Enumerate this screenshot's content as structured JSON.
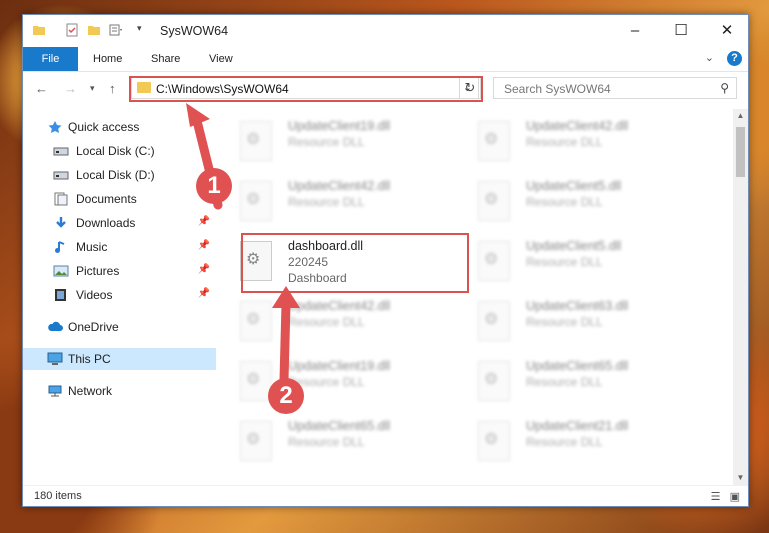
{
  "window": {
    "title": "SysWOW64"
  },
  "ribbon": {
    "tabs": [
      "File",
      "Home",
      "Share",
      "View"
    ]
  },
  "address": {
    "path": "C:\\Windows\\SysWOW64"
  },
  "search": {
    "placeholder": "Search SysWOW64"
  },
  "sidebar": {
    "items": [
      {
        "label": "Quick access",
        "icon": "star-icon",
        "pinned": false
      },
      {
        "label": "Local Disk (C:)",
        "icon": "drive-icon",
        "pinned": false
      },
      {
        "label": "Local Disk (D:)",
        "icon": "drive-icon",
        "pinned": false
      },
      {
        "label": "Documents",
        "icon": "documents-icon",
        "pinned": false
      },
      {
        "label": "Downloads",
        "icon": "download-icon",
        "pinned": true
      },
      {
        "label": "Music",
        "icon": "music-icon",
        "pinned": true
      },
      {
        "label": "Pictures",
        "icon": "pictures-icon",
        "pinned": true
      },
      {
        "label": "Videos",
        "icon": "video-icon",
        "pinned": true
      },
      {
        "label": "OneDrive",
        "icon": "cloud-icon",
        "pinned": false
      },
      {
        "label": "This PC",
        "icon": "computer-icon",
        "pinned": false
      },
      {
        "label": "Network",
        "icon": "network-icon",
        "pinned": false
      }
    ]
  },
  "files": [
    {
      "name": "UpdateClient19.dll",
      "sub1": "Resource DLL",
      "sub2": ""
    },
    {
      "name": "UpdateClient42.dll",
      "sub1": "Resource DLL",
      "sub2": ""
    },
    {
      "name": "UpdateClient42.dll",
      "sub1": "Resource DLL",
      "sub2": ""
    },
    {
      "name": "UpdateClient5.dll",
      "sub1": "Resource DLL",
      "sub2": ""
    },
    {
      "name": "dashboard.dll",
      "sub1": "220245",
      "sub2": "Dashboard"
    },
    {
      "name": "UpdateClient5.dll",
      "sub1": "Resource DLL",
      "sub2": ""
    },
    {
      "name": "UpdateClient42.dll",
      "sub1": "Resource DLL",
      "sub2": ""
    },
    {
      "name": "UpdateClient63.dll",
      "sub1": "Resource DLL",
      "sub2": ""
    },
    {
      "name": "UpdateClient19.dll",
      "sub1": "Resource DLL",
      "sub2": ""
    },
    {
      "name": "UpdateClient65.dll",
      "sub1": "Resource DLL",
      "sub2": ""
    },
    {
      "name": "UpdateClient65.dll",
      "sub1": "Resource DLL",
      "sub2": ""
    },
    {
      "name": "UpdateClient21.dll",
      "sub1": "Resource DLL",
      "sub2": ""
    }
  ],
  "status": {
    "items": "180 items"
  },
  "annotations": {
    "badge1": "1",
    "badge2": "2"
  },
  "colors": {
    "accent": "#1979ca",
    "highlight": "#d9534f",
    "selected": "#cce8ff"
  }
}
